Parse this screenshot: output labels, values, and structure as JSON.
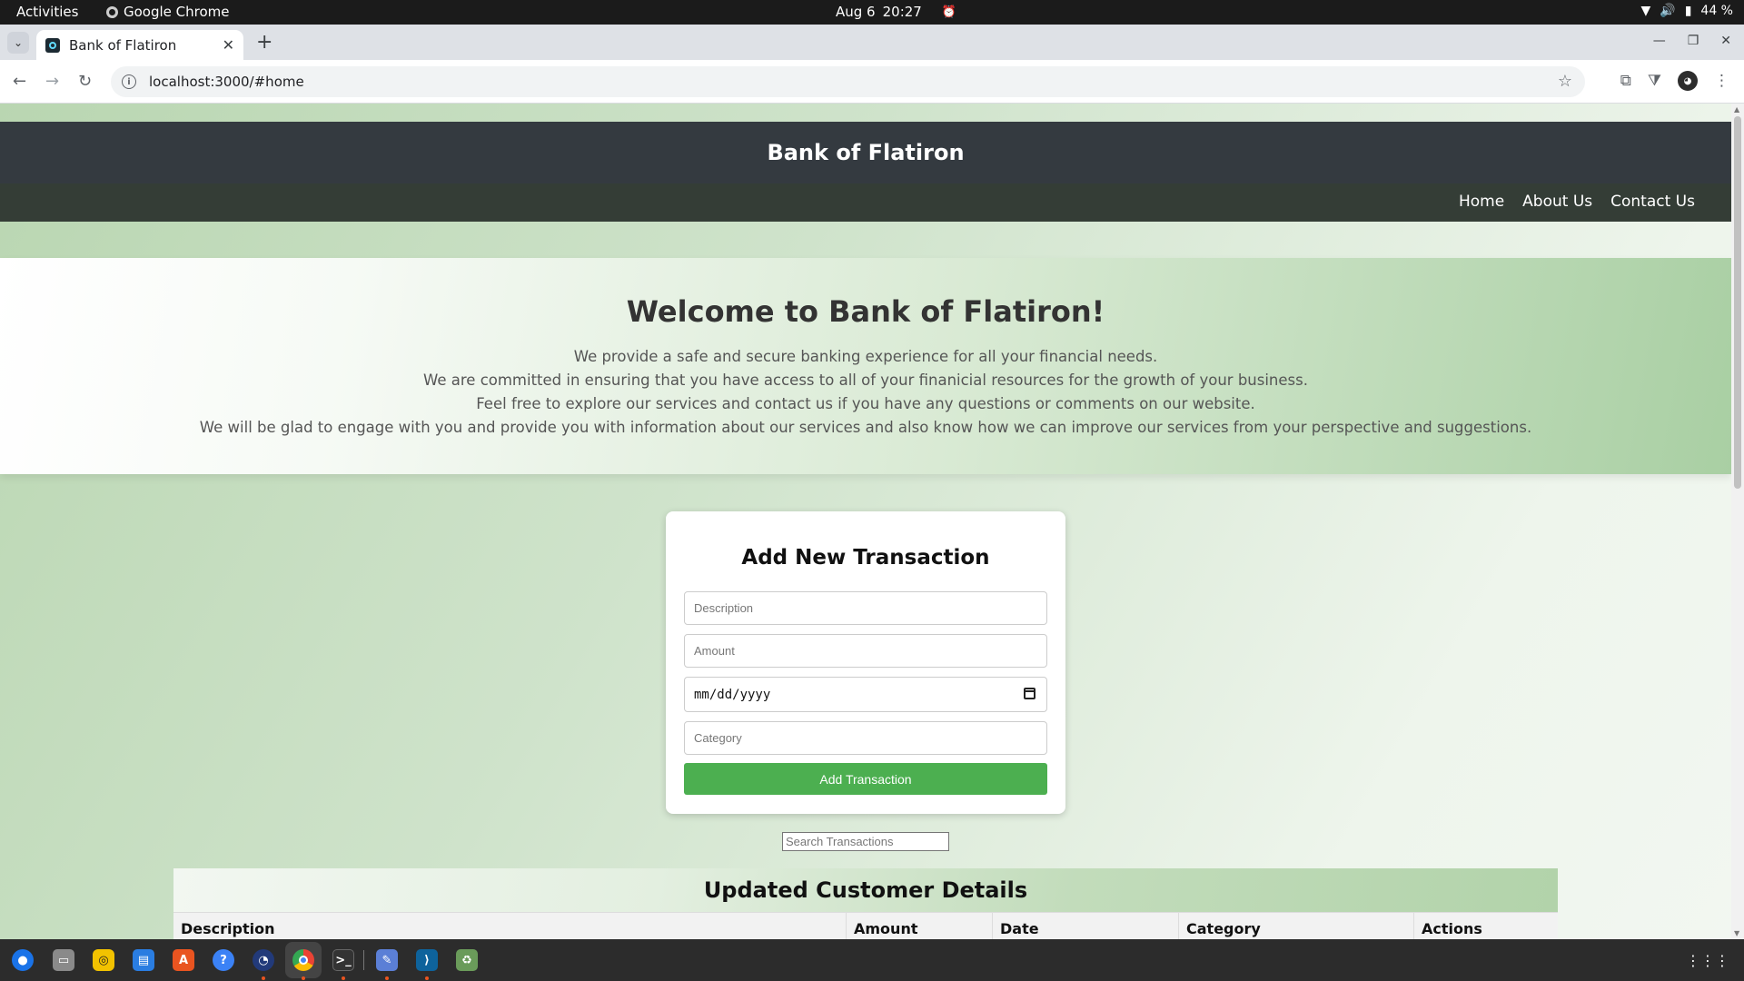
{
  "system_bar": {
    "activities": "Activities",
    "app_name": "Google Chrome",
    "date": "Aug 6",
    "time": "20:27",
    "battery": "44 %"
  },
  "browser": {
    "tab_title": "Bank of Flatiron",
    "url": "localhost:3000/#home"
  },
  "site": {
    "title": "Bank of Flatiron",
    "nav": {
      "home": "Home",
      "about": "About Us",
      "contact": "Contact Us"
    },
    "hero": {
      "heading": "Welcome to Bank of Flatiron!",
      "line1": "We provide a safe and secure banking experience for all your financial needs.",
      "line2": "We are committed in ensuring that you have access to all of your finanicial resources for the growth of your business.",
      "line3": "Feel free to explore our services and contact us if you have any questions or comments on our website.",
      "line4": "We will be glad to engage with you and provide you with information about our services and also know how we can improve our services from your perspective and suggestions."
    },
    "form": {
      "heading": "Add New Transaction",
      "description_placeholder": "Description",
      "amount_placeholder": "Amount",
      "date_placeholder": "mm/dd/yyyy",
      "category_placeholder": "Category",
      "submit_label": "Add Transaction",
      "button_color": "#4caf50"
    },
    "search_placeholder": "Search Transactions",
    "table": {
      "title": "Updated Customer Details",
      "columns": [
        "Description",
        "Amount",
        "Date",
        "Category",
        "Actions"
      ]
    }
  },
  "dock_icons": [
    "thunderbird-icon",
    "files-icon",
    "rhythmbox-icon",
    "writer-icon",
    "app-center-icon",
    "help-icon",
    "backup-icon",
    "chrome-icon",
    "terminal-icon",
    "text-editor-icon",
    "vscode-icon",
    "trash-icon"
  ]
}
